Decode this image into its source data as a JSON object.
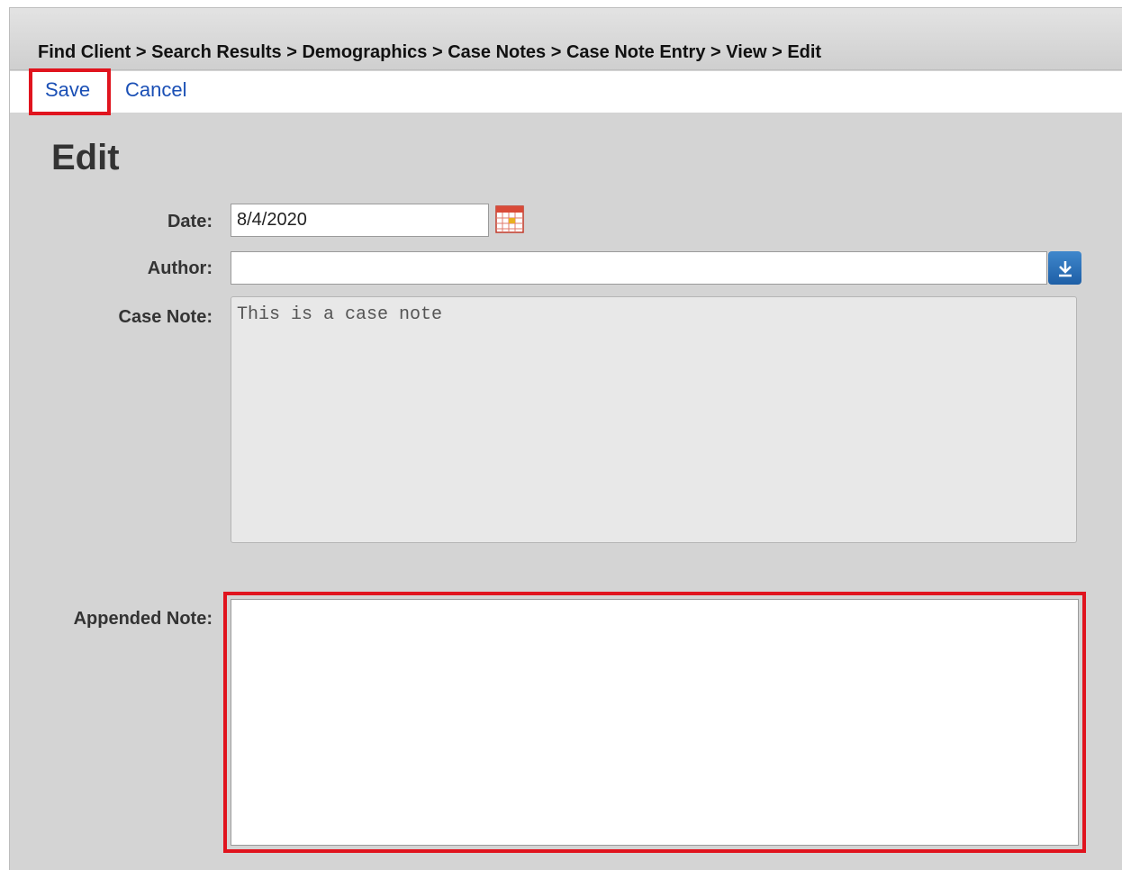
{
  "breadcrumb": {
    "items": [
      "Find Client",
      "Search Results",
      "Demographics",
      "Case Notes",
      "Case Note Entry",
      "View",
      "Edit"
    ],
    "separator": ">"
  },
  "toolbar": {
    "save_label": "Save",
    "cancel_label": "Cancel"
  },
  "form": {
    "title": "Edit",
    "date_label": "Date:",
    "date_value": "8/4/2020",
    "author_label": "Author:",
    "author_value": "",
    "case_note_label": "Case Note:",
    "case_note_value": "This is a case note",
    "appended_note_label": "Appended Note:",
    "appended_note_value": ""
  },
  "icons": {
    "calendar": "calendar-icon",
    "dropdown": "download-arrow-icon"
  },
  "colors": {
    "highlight": "#e0141e",
    "link": "#1a4fb5",
    "dropdown_button": "#2a6fba",
    "page_background": "#d4d4d4"
  }
}
